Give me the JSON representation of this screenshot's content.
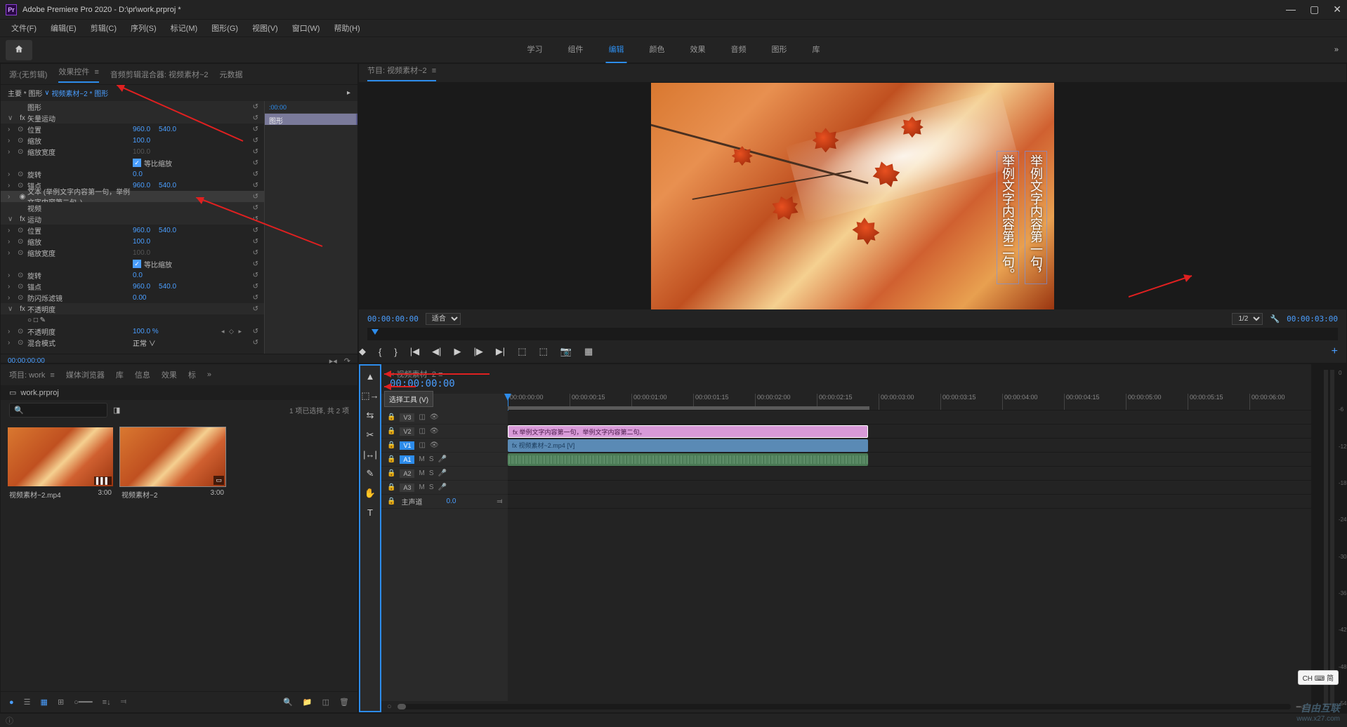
{
  "app": {
    "name": "Adobe Premiere Pro 2020",
    "project_path": "D:\\pr\\work.prproj *"
  },
  "menus": [
    "文件(F)",
    "编辑(E)",
    "剪辑(C)",
    "序列(S)",
    "标记(M)",
    "图形(G)",
    "视图(V)",
    "窗口(W)",
    "帮助(H)"
  ],
  "workspaces": {
    "items": [
      "学习",
      "组件",
      "编辑",
      "颜色",
      "效果",
      "音频",
      "图形",
      "库"
    ],
    "active": 2
  },
  "source_panel": {
    "tabs": [
      "源:(无剪辑)",
      "效果控件",
      "音频剪辑混合器: 视频素材~2",
      "元数据"
    ],
    "active": 1,
    "master_label": "主要 * 图形",
    "clip_label": "视频素材~2 * 图形",
    "timeline_start": ":00:00",
    "timeline_clip_name": "图形",
    "footer_tc": "00:00:00:00"
  },
  "effects": {
    "sections": [
      {
        "name": "图形",
        "items": []
      },
      {
        "name": "矢量运动",
        "fx": true,
        "items": [
          {
            "label": "位置",
            "vals": [
              "960.0",
              "540.0"
            ]
          },
          {
            "label": "缩放",
            "vals": [
              "100.0"
            ]
          },
          {
            "label": "缩放宽度",
            "vals": [
              "100.0"
            ],
            "dim": true
          },
          {
            "label": "",
            "check": "等比缩放"
          },
          {
            "label": "旋转",
            "vals": [
              "0.0"
            ]
          },
          {
            "label": "锚点",
            "vals": [
              "960.0",
              "540.0"
            ]
          }
        ]
      },
      {
        "name": "文本 (举例文字内容第一句，举例文字内容第二句。)",
        "eye": true,
        "highlighted": true,
        "items": []
      },
      {
        "name": "视频",
        "items": []
      },
      {
        "name": "运动",
        "fx": true,
        "items": [
          {
            "label": "位置",
            "vals": [
              "960.0",
              "540.0"
            ]
          },
          {
            "label": "缩放",
            "vals": [
              "100.0"
            ]
          },
          {
            "label": "缩放宽度",
            "vals": [
              "100.0"
            ],
            "dim": true
          },
          {
            "label": "",
            "check": "等比缩放"
          },
          {
            "label": "旋转",
            "vals": [
              "0.0"
            ]
          },
          {
            "label": "锚点",
            "vals": [
              "960.0",
              "540.0"
            ]
          },
          {
            "label": "防闪烁滤镜",
            "vals": [
              "0.00"
            ]
          }
        ]
      },
      {
        "name": "不透明度",
        "fx": true,
        "masks": true,
        "items": [
          {
            "label": "不透明度",
            "vals": [
              "100.0 %"
            ],
            "keyed": true
          },
          {
            "label": "混合模式",
            "dropdown": "正常"
          }
        ]
      }
    ]
  },
  "program": {
    "title": "节目: 视频素材~2",
    "tc_left": "00:00:00:00",
    "fit": "适合",
    "zoom": "1/2",
    "tc_right": "00:00:03:00",
    "overlay_text1": "举例文字内容第一句，",
    "overlay_text2": "举例文字内容第二句。"
  },
  "project": {
    "tabs": [
      "项目: work",
      "媒体浏览器",
      "库",
      "信息",
      "效果",
      "标"
    ],
    "active": 0,
    "bin_path": "work.prproj",
    "search_placeholder": "",
    "selection_info": "1 项已选择, 共 2 项",
    "items": [
      {
        "name": "视频素材~2.mp4",
        "dur": "3:00"
      },
      {
        "name": "视频素材~2",
        "dur": "3:00"
      }
    ]
  },
  "timeline": {
    "seq_name": "视频素材~2",
    "tc": "00:00:00:00",
    "tooltip": "选择工具 (V)",
    "ruler": [
      "00:00:00:00",
      "00:00:00:15",
      "00:00:01:00",
      "00:00:01:15",
      "00:00:02:00",
      "00:00:02:15",
      "00:00:03:00",
      "00:00:03:15",
      "00:00:04:00",
      "00:00:04:15",
      "00:00:05:00",
      "00:00:05:15",
      "00:00:06:00"
    ],
    "tracks_v": [
      "V3",
      "V2",
      "V1"
    ],
    "tracks_a": [
      "A1",
      "A2",
      "A3"
    ],
    "master": "主声道",
    "master_lvl": "0.0",
    "clips": {
      "gfx_text": "举例文字内容第一句，举例文字内容第二句。",
      "vid_name": "视频素材~2.mp4 [V]"
    }
  },
  "meter_labels": [
    "0",
    "-6",
    "-12",
    "-18",
    "-24",
    "-30",
    "-36",
    "-42",
    "-48",
    "-54"
  ],
  "ime": "CH ⌨ 简",
  "watermark": {
    "brand": "自由互联",
    "url": "www.x27.com"
  }
}
